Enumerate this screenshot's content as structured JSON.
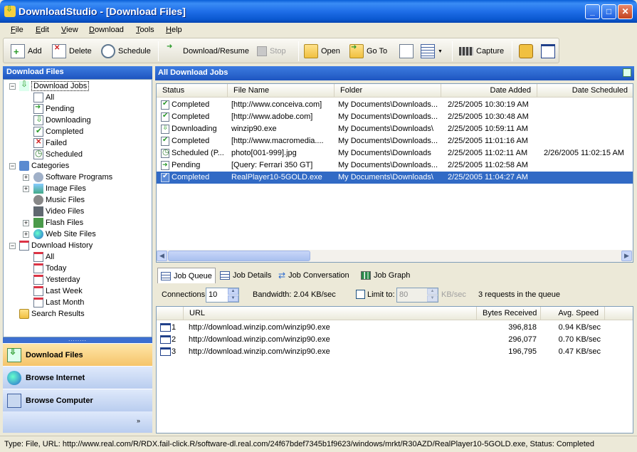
{
  "window": {
    "title": "DownloadStudio - [Download Files]"
  },
  "menu": [
    "File",
    "Edit",
    "View",
    "Download",
    "Tools",
    "Help"
  ],
  "toolbar": {
    "add": "Add",
    "delete": "Delete",
    "schedule": "Schedule",
    "download_resume": "Download/Resume",
    "stop": "Stop",
    "open": "Open",
    "go_to": "Go To",
    "capture": "Capture"
  },
  "left_panel": {
    "title": "Download Files",
    "tree": {
      "download_jobs": "Download Jobs",
      "jobs": [
        "All",
        "Pending",
        "Downloading",
        "Completed",
        "Failed",
        "Scheduled"
      ],
      "categories": "Categories",
      "category_items": [
        "Software Programs",
        "Image Files",
        "Music Files",
        "Video Files",
        "Flash Files",
        "Web Site Files"
      ],
      "download_history": "Download History",
      "history_items": [
        "All",
        "Today",
        "Yesterday",
        "Last Week",
        "Last Month"
      ],
      "search_results": "Search Results"
    },
    "nav": [
      "Download Files",
      "Browse Internet",
      "Browse Computer"
    ]
  },
  "jobs_panel": {
    "title": "All Download Jobs",
    "columns": [
      "Status",
      "File Name",
      "Folder",
      "Date Added",
      "Date Scheduled"
    ],
    "rows": [
      {
        "status": "Completed",
        "file": "[http://www.conceiva.com]",
        "folder": "My Documents\\Downloads...",
        "added": "2/25/2005 10:30:19 AM",
        "scheduled": ""
      },
      {
        "status": "Completed",
        "file": "[http://www.adobe.com]",
        "folder": "My Documents\\Downloads...",
        "added": "2/25/2005 10:30:48 AM",
        "scheduled": ""
      },
      {
        "status": "Downloading",
        "file": "winzip90.exe",
        "folder": "My Documents\\Downloads\\",
        "added": "2/25/2005 10:59:11 AM",
        "scheduled": ""
      },
      {
        "status": "Completed",
        "file": "[http://www.macromedia....",
        "folder": "My Documents\\Downloads...",
        "added": "2/25/2005 11:01:16 AM",
        "scheduled": ""
      },
      {
        "status": "Scheduled (P...",
        "file": "photo[001-999].jpg",
        "folder": "My Documents\\Downloads",
        "added": "2/25/2005 11:02:11 AM",
        "scheduled": "2/26/2005 11:02:15 AM"
      },
      {
        "status": "Pending",
        "file": "[Query: Ferrari 350 GT]",
        "folder": "My Documents\\Downloads...",
        "added": "2/25/2005 11:02:58 AM",
        "scheduled": ""
      },
      {
        "status": "Completed",
        "file": "RealPlayer10-5GOLD.exe",
        "folder": "My Documents\\Downloads\\",
        "added": "2/25/2005 11:04:27 AM",
        "scheduled": ""
      }
    ]
  },
  "tabs": [
    "Job Queue",
    "Job Details",
    "Job Conversation",
    "Job Graph"
  ],
  "options": {
    "connections_label": "Connections:",
    "connections_value": "10",
    "bandwidth": "Bandwidth: 2.04 KB/sec",
    "limit_label": "Limit to:",
    "limit_value": "80",
    "limit_unit": "KB/sec",
    "queue_info": "3 requests in the queue"
  },
  "queue": {
    "columns": [
      "URL",
      "Bytes Received",
      "Avg. Speed"
    ],
    "rows": [
      {
        "n": "1",
        "url": "http://download.winzip.com/winzip90.exe",
        "bytes": "396,818",
        "speed": "0.94 KB/sec"
      },
      {
        "n": "2",
        "url": "http://download.winzip.com/winzip90.exe",
        "bytes": "296,077",
        "speed": "0.70 KB/sec"
      },
      {
        "n": "3",
        "url": "http://download.winzip.com/winzip90.exe",
        "bytes": "196,795",
        "speed": "0.47 KB/sec"
      }
    ]
  },
  "status_bar": "Type: File, URL: http://www.real.com/R/RDX.fail-click.R/software-dl.real.com/24f67bdef7345b1f9623/windows/mrkt/R30AZD/RealPlayer10-5GOLD.exe, Status: Completed"
}
